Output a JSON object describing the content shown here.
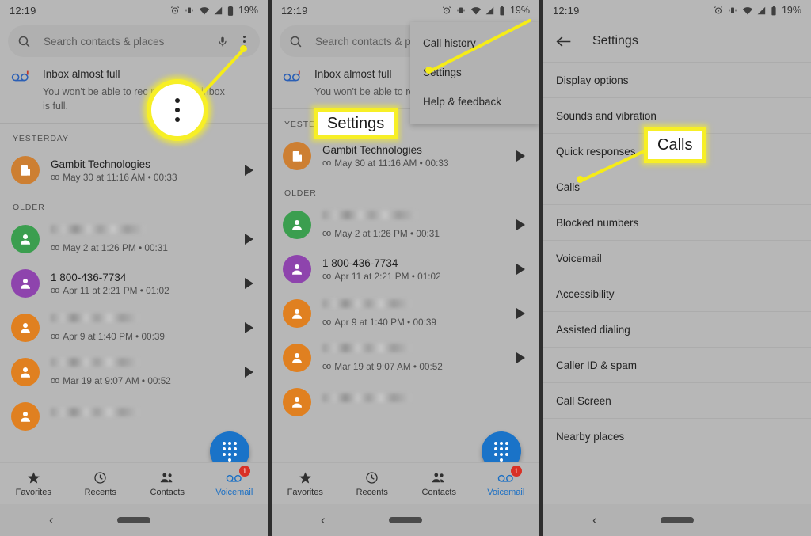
{
  "statusbar": {
    "time": "12:19",
    "battery_percent": "19%",
    "icons": [
      "alarm-icon",
      "vibrate-icon",
      "wifi-icon",
      "signal-icon",
      "battery-icon"
    ]
  },
  "panel1": {
    "search": {
      "placeholder": "Search contacts & places",
      "search_icon": "search-icon",
      "mic_icon": "microphone-icon",
      "overflow_icon": "kebab-menu-icon"
    },
    "promo": {
      "icon": "voicemail-icon",
      "title": "Inbox almost full",
      "text_part1": "You won't be able to rec",
      "text_part2": "mail if",
      "text_line2": "your inbox is full."
    },
    "sections": [
      {
        "label": "YESTERDAY",
        "rows": [
          {
            "name": "Gambit Technologies",
            "name_blurred": false,
            "avatar_color": "#cd7f32",
            "avatar_icon": "building-icon",
            "meta": "May 30 at 11:16 AM • 00:33",
            "voicemail_glyph": "oo",
            "play_icon": "play-icon"
          }
        ]
      },
      {
        "label": "OLDER",
        "rows": [
          {
            "name": "",
            "name_blurred": true,
            "avatar_color": "#3b9e4f",
            "avatar_icon": "person-icon",
            "meta": "May 2 at 1:26 PM • 00:31",
            "voicemail_glyph": "oo",
            "play_icon": "play-icon"
          },
          {
            "name": "1 800-436-7734",
            "name_blurred": false,
            "avatar_color": "#8e44ad",
            "avatar_icon": "person-icon",
            "meta": "Apr 11 at 2:21 PM • 01:02",
            "voicemail_glyph": "oo",
            "play_icon": "play-icon"
          },
          {
            "name": "",
            "name_blurred": true,
            "avatar_color": "#e08020",
            "avatar_icon": "person-icon",
            "meta": "Apr 9 at 1:40 PM • 00:39",
            "voicemail_glyph": "oo",
            "play_icon": "play-icon"
          },
          {
            "name": "",
            "name_blurred": true,
            "avatar_color": "#e08020",
            "avatar_icon": "person-icon",
            "meta": "Mar 19 at 9:07 AM • 00:52",
            "voicemail_glyph": "oo",
            "play_icon": "play-icon"
          },
          {
            "name": "",
            "name_blurred": true,
            "avatar_color": "#e08020",
            "avatar_icon": "person-icon",
            "meta": "",
            "voicemail_glyph": "",
            "play_icon": ""
          }
        ]
      }
    ],
    "fab": {
      "icon": "dialpad-icon"
    },
    "tabs": [
      {
        "label": "Favorites",
        "icon": "star-icon",
        "active": false,
        "badge": ""
      },
      {
        "label": "Recents",
        "icon": "clock-icon",
        "active": false,
        "badge": ""
      },
      {
        "label": "Contacts",
        "icon": "people-icon",
        "active": false,
        "badge": ""
      },
      {
        "label": "Voicemail",
        "icon": "voicemail-icon",
        "active": true,
        "badge": "1"
      }
    ],
    "navbar": {
      "back_icon": "back-chevron-icon",
      "home_pill": "home-pill"
    }
  },
  "panel2": {
    "dropdown": {
      "items": [
        "Call history",
        "Settings",
        "Help & feedback"
      ]
    },
    "callout": {
      "label": "Settings"
    }
  },
  "panel3": {
    "header": {
      "back_icon": "back-arrow-icon",
      "title": "Settings"
    },
    "rows": [
      "Display options",
      "Sounds and vibration",
      "Quick responses",
      "Calls",
      "Blocked numbers",
      "Voicemail",
      "Accessibility",
      "Assisted dialing",
      "Caller ID & spam",
      "Call Screen",
      "Nearby places"
    ],
    "callout": {
      "label": "Calls"
    }
  },
  "colors": {
    "panel_bg": "#b7b7b7",
    "accent_blue": "#1a73c8",
    "highlight_yellow": "#f7ef26",
    "badge_red": "#d93025"
  }
}
